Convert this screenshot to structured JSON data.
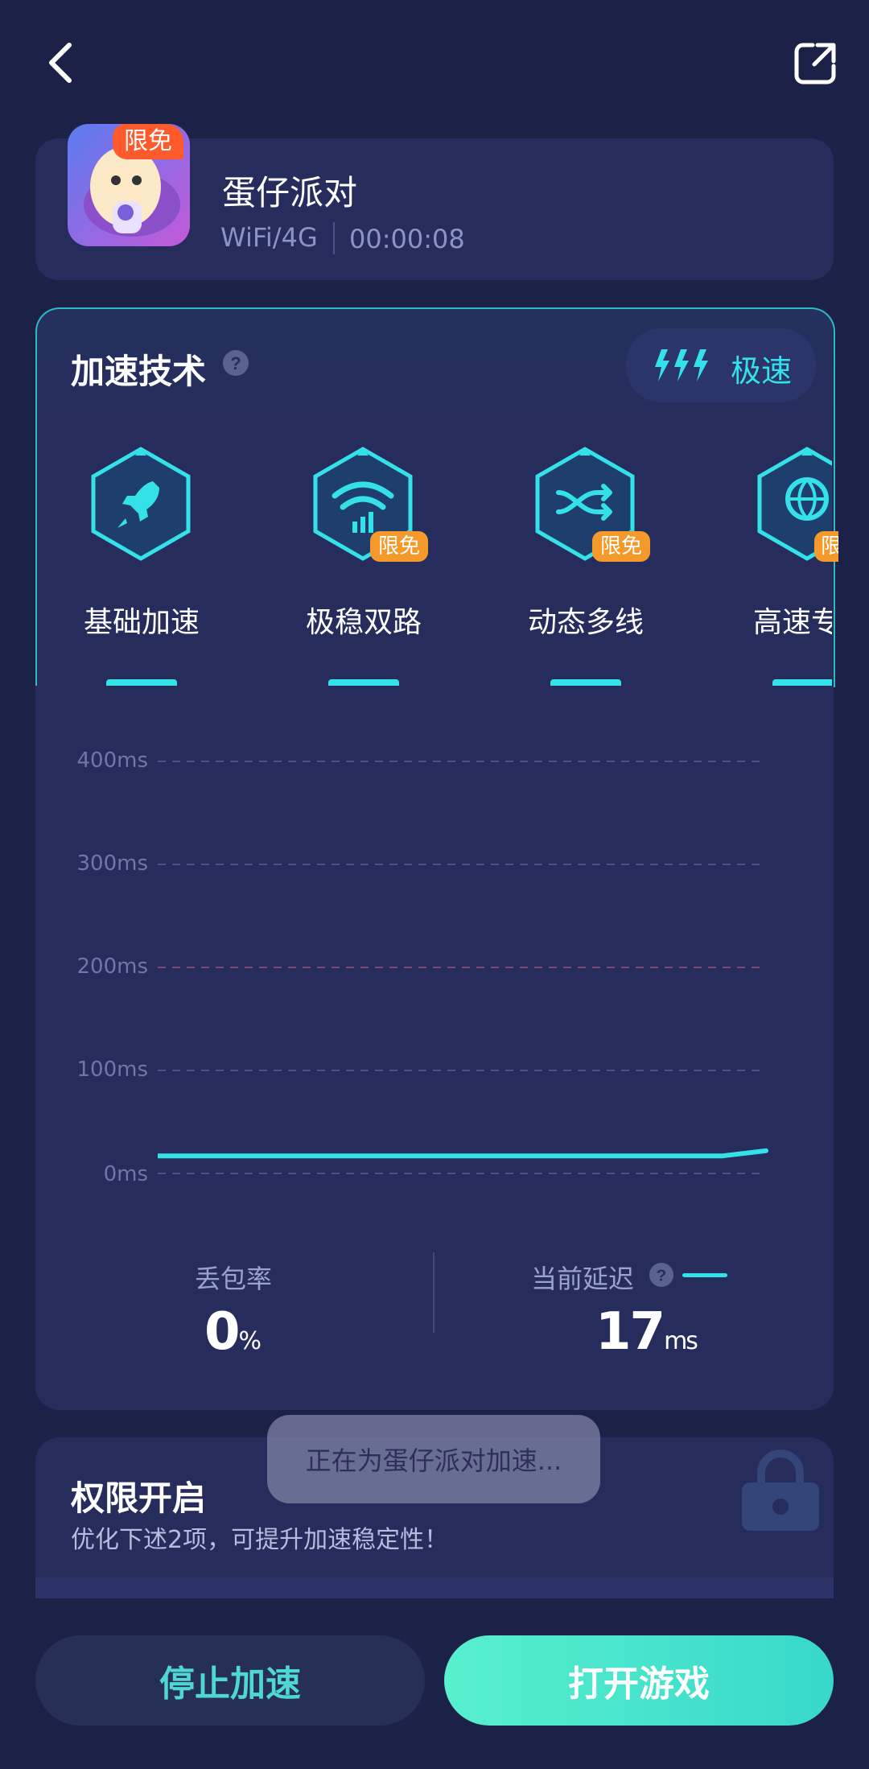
{
  "app": {
    "name": "蛋仔派对",
    "badge": "限免",
    "network": "WiFi/4G",
    "timer": "00:00:08"
  },
  "tech": {
    "title": "加速技术",
    "mode": "极速",
    "items": [
      {
        "label": "基础加速",
        "badge": ""
      },
      {
        "label": "极稳双路",
        "badge": "限免"
      },
      {
        "label": "动态多线",
        "badge": "限免"
      },
      {
        "label": "高速专",
        "badge": "限"
      }
    ]
  },
  "chart_data": {
    "type": "line",
    "title": "",
    "xlabel": "",
    "ylabel": "",
    "y_ticks": [
      "400ms",
      "300ms",
      "200ms",
      "100ms",
      "0ms"
    ],
    "ylim": [
      0,
      400
    ],
    "series": [
      {
        "values": [
          17,
          17,
          17,
          17,
          17,
          17,
          17,
          17,
          17,
          17,
          17,
          17,
          17,
          17,
          22
        ]
      }
    ]
  },
  "stats": {
    "loss_label": "丢包率",
    "loss_value": "0",
    "loss_unit": "%",
    "latency_label": "当前延迟",
    "latency_value": "17",
    "latency_unit": "ms"
  },
  "permission": {
    "title": "权限开启",
    "desc": "优化下述2项，可提升加速稳定性！"
  },
  "toast": "正在为蛋仔派对加速...",
  "buttons": {
    "stop": "停止加速",
    "open": "打开游戏"
  },
  "colors": {
    "accent": "#35e1e8",
    "background": "#1c2148",
    "card": "#262c5c",
    "free_badge": "#ff5a2c"
  }
}
